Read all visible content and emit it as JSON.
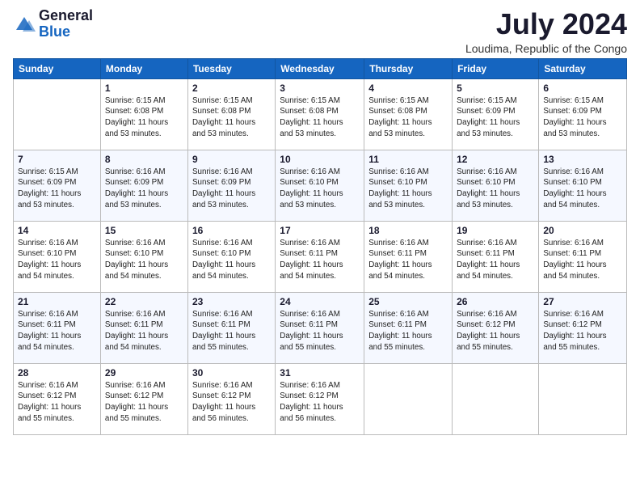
{
  "logo": {
    "general": "General",
    "blue": "Blue"
  },
  "title": "July 2024",
  "location": "Loudima, Republic of the Congo",
  "days_header": [
    "Sunday",
    "Monday",
    "Tuesday",
    "Wednesday",
    "Thursday",
    "Friday",
    "Saturday"
  ],
  "weeks": [
    [
      {
        "day": "",
        "info": ""
      },
      {
        "day": "1",
        "info": "Sunrise: 6:15 AM\nSunset: 6:08 PM\nDaylight: 11 hours\nand 53 minutes."
      },
      {
        "day": "2",
        "info": "Sunrise: 6:15 AM\nSunset: 6:08 PM\nDaylight: 11 hours\nand 53 minutes."
      },
      {
        "day": "3",
        "info": "Sunrise: 6:15 AM\nSunset: 6:08 PM\nDaylight: 11 hours\nand 53 minutes."
      },
      {
        "day": "4",
        "info": "Sunrise: 6:15 AM\nSunset: 6:08 PM\nDaylight: 11 hours\nand 53 minutes."
      },
      {
        "day": "5",
        "info": "Sunrise: 6:15 AM\nSunset: 6:09 PM\nDaylight: 11 hours\nand 53 minutes."
      },
      {
        "day": "6",
        "info": "Sunrise: 6:15 AM\nSunset: 6:09 PM\nDaylight: 11 hours\nand 53 minutes."
      }
    ],
    [
      {
        "day": "7",
        "info": "Sunrise: 6:15 AM\nSunset: 6:09 PM\nDaylight: 11 hours\nand 53 minutes."
      },
      {
        "day": "8",
        "info": "Sunrise: 6:16 AM\nSunset: 6:09 PM\nDaylight: 11 hours\nand 53 minutes."
      },
      {
        "day": "9",
        "info": "Sunrise: 6:16 AM\nSunset: 6:09 PM\nDaylight: 11 hours\nand 53 minutes."
      },
      {
        "day": "10",
        "info": "Sunrise: 6:16 AM\nSunset: 6:10 PM\nDaylight: 11 hours\nand 53 minutes."
      },
      {
        "day": "11",
        "info": "Sunrise: 6:16 AM\nSunset: 6:10 PM\nDaylight: 11 hours\nand 53 minutes."
      },
      {
        "day": "12",
        "info": "Sunrise: 6:16 AM\nSunset: 6:10 PM\nDaylight: 11 hours\nand 53 minutes."
      },
      {
        "day": "13",
        "info": "Sunrise: 6:16 AM\nSunset: 6:10 PM\nDaylight: 11 hours\nand 54 minutes."
      }
    ],
    [
      {
        "day": "14",
        "info": "Sunrise: 6:16 AM\nSunset: 6:10 PM\nDaylight: 11 hours\nand 54 minutes."
      },
      {
        "day": "15",
        "info": "Sunrise: 6:16 AM\nSunset: 6:10 PM\nDaylight: 11 hours\nand 54 minutes."
      },
      {
        "day": "16",
        "info": "Sunrise: 6:16 AM\nSunset: 6:10 PM\nDaylight: 11 hours\nand 54 minutes."
      },
      {
        "day": "17",
        "info": "Sunrise: 6:16 AM\nSunset: 6:11 PM\nDaylight: 11 hours\nand 54 minutes."
      },
      {
        "day": "18",
        "info": "Sunrise: 6:16 AM\nSunset: 6:11 PM\nDaylight: 11 hours\nand 54 minutes."
      },
      {
        "day": "19",
        "info": "Sunrise: 6:16 AM\nSunset: 6:11 PM\nDaylight: 11 hours\nand 54 minutes."
      },
      {
        "day": "20",
        "info": "Sunrise: 6:16 AM\nSunset: 6:11 PM\nDaylight: 11 hours\nand 54 minutes."
      }
    ],
    [
      {
        "day": "21",
        "info": "Sunrise: 6:16 AM\nSunset: 6:11 PM\nDaylight: 11 hours\nand 54 minutes."
      },
      {
        "day": "22",
        "info": "Sunrise: 6:16 AM\nSunset: 6:11 PM\nDaylight: 11 hours\nand 54 minutes."
      },
      {
        "day": "23",
        "info": "Sunrise: 6:16 AM\nSunset: 6:11 PM\nDaylight: 11 hours\nand 55 minutes."
      },
      {
        "day": "24",
        "info": "Sunrise: 6:16 AM\nSunset: 6:11 PM\nDaylight: 11 hours\nand 55 minutes."
      },
      {
        "day": "25",
        "info": "Sunrise: 6:16 AM\nSunset: 6:11 PM\nDaylight: 11 hours\nand 55 minutes."
      },
      {
        "day": "26",
        "info": "Sunrise: 6:16 AM\nSunset: 6:12 PM\nDaylight: 11 hours\nand 55 minutes."
      },
      {
        "day": "27",
        "info": "Sunrise: 6:16 AM\nSunset: 6:12 PM\nDaylight: 11 hours\nand 55 minutes."
      }
    ],
    [
      {
        "day": "28",
        "info": "Sunrise: 6:16 AM\nSunset: 6:12 PM\nDaylight: 11 hours\nand 55 minutes."
      },
      {
        "day": "29",
        "info": "Sunrise: 6:16 AM\nSunset: 6:12 PM\nDaylight: 11 hours\nand 55 minutes."
      },
      {
        "day": "30",
        "info": "Sunrise: 6:16 AM\nSunset: 6:12 PM\nDaylight: 11 hours\nand 56 minutes."
      },
      {
        "day": "31",
        "info": "Sunrise: 6:16 AM\nSunset: 6:12 PM\nDaylight: 11 hours\nand 56 minutes."
      },
      {
        "day": "",
        "info": ""
      },
      {
        "day": "",
        "info": ""
      },
      {
        "day": "",
        "info": ""
      }
    ]
  ]
}
